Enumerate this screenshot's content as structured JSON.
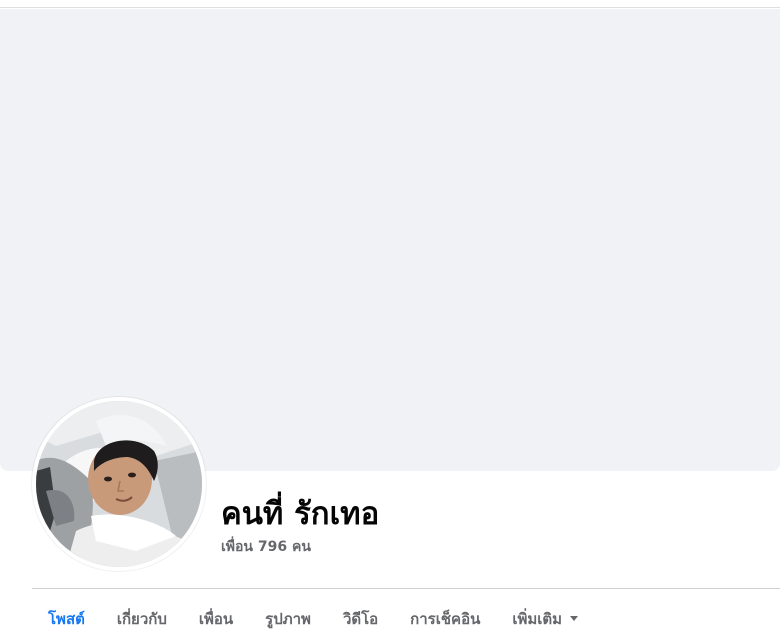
{
  "profile": {
    "name": "คนที่ รักเทอ",
    "friends_text": "เพื่อน 796 คน"
  },
  "tabs": [
    {
      "label": "โพสต์",
      "active": true
    },
    {
      "label": "เกี่ยวกับ",
      "active": false
    },
    {
      "label": "เพื่อน",
      "active": false
    },
    {
      "label": "รูปภาพ",
      "active": false
    },
    {
      "label": "วิดีโอ",
      "active": false
    },
    {
      "label": "การเช็คอิน",
      "active": false
    },
    {
      "label": "เพิ่มเติม",
      "active": false,
      "icon": "caret-down-icon"
    }
  ],
  "colors": {
    "cover_background": "#f0f2f5",
    "active_tab": "#1877f2",
    "secondary_text": "#65676b",
    "primary_text": "#050505"
  }
}
